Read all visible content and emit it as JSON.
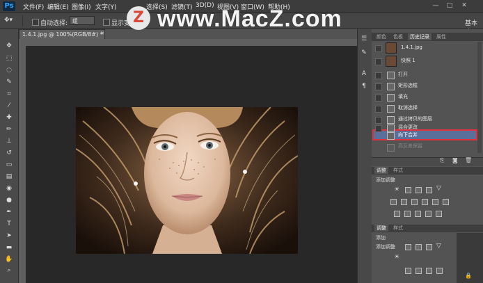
{
  "app": {
    "logo": "Ps",
    "title": "Photoshop"
  },
  "menu": [
    "文件(F)",
    "编辑(E)",
    "图像(I)",
    "文字(Y)",
    "选择(S)",
    "滤镜(T)",
    "3D(D)",
    "视图(V)",
    "窗口(W)",
    "帮助(H)"
  ],
  "window_controls": {
    "minimize": "—",
    "maximize": "□",
    "close": "✕"
  },
  "options_bar": {
    "auto_select_label": "自动选择:",
    "auto_select_value": "组",
    "show_transform_label": "显示变",
    "workspace_label": "基本功"
  },
  "watermark": {
    "logo_letter": "Z",
    "text": "www.MacZ.com"
  },
  "document": {
    "tab_title": "1.4.1.jpg @ 100%(RGB/8#) *",
    "close": "×"
  },
  "panels": {
    "tabs": [
      "颜色",
      "色板",
      "历史记录",
      "属性"
    ],
    "active_tab": "历史记录",
    "history_snapshot_name": "1.4.1.jpg",
    "history_snapshot2": "快照 1",
    "history_items": [
      "打开",
      "矩形选框",
      "填充",
      "取消选择",
      "通过拷贝的图层",
      "混合更改",
      "向下合并",
      "高反差保留"
    ],
    "history_selected": "向下合并",
    "adj1_tabs": [
      "调整",
      "样式"
    ],
    "adj1_title": "添加调整",
    "adj2_tabs": [
      "调整",
      "样式"
    ],
    "adj2_title1": "添加",
    "adj2_title2": "添加调整"
  },
  "colors": {
    "highlight_border": "#e0323a",
    "selected_row": "#5b6f9b",
    "watermark_logo": "#d94a3a"
  }
}
